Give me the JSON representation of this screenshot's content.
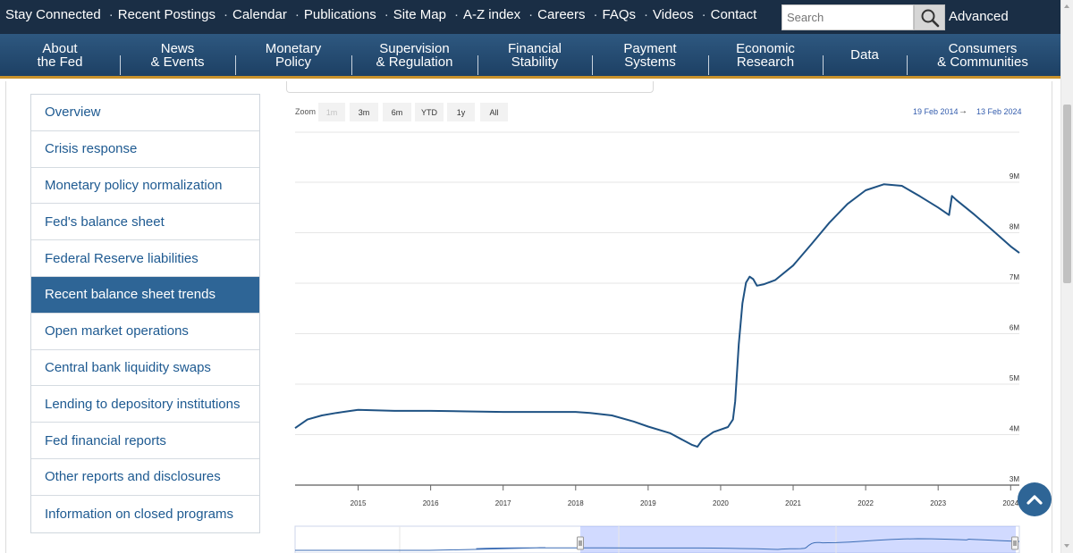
{
  "topbar": {
    "links": [
      "Stay Connected",
      "Recent Postings",
      "Calendar",
      "Publications",
      "Site Map",
      "A-Z index",
      "Careers",
      "FAQs",
      "Videos",
      "Contact"
    ],
    "search_placeholder": "Search",
    "advanced_label": "Advanced"
  },
  "nav": {
    "items": [
      "About\nthe Fed",
      "News\n& Events",
      "Monetary\nPolicy",
      "Supervision\n& Regulation",
      "Financial\nStability",
      "Payment\nSystems",
      "Economic\nResearch",
      "Data",
      "Consumers\n& Communities"
    ]
  },
  "sidebar": {
    "items": [
      {
        "label": "Overview",
        "active": false
      },
      {
        "label": "Crisis response",
        "active": false
      },
      {
        "label": "Monetary policy normalization",
        "active": false
      },
      {
        "label": "Fed's balance sheet",
        "active": false
      },
      {
        "label": "Federal Reserve liabilities",
        "active": false
      },
      {
        "label": "Recent balance sheet trends",
        "active": true
      },
      {
        "label": "Open market operations",
        "active": false
      },
      {
        "label": "Central bank liquidity swaps",
        "active": false
      },
      {
        "label": "Lending to depository institutions",
        "active": false
      },
      {
        "label": "Fed financial reports",
        "active": false
      },
      {
        "label": "Other reports and disclosures",
        "active": false
      },
      {
        "label": "Information on closed programs",
        "active": false
      }
    ]
  },
  "range_selector": {
    "zoom_label": "Zoom",
    "buttons": [
      {
        "label": "1m",
        "enabled": false
      },
      {
        "label": "3m",
        "enabled": true
      },
      {
        "label": "6m",
        "enabled": true
      },
      {
        "label": "YTD",
        "enabled": true
      },
      {
        "label": "1y",
        "enabled": true
      },
      {
        "label": "All",
        "enabled": true
      }
    ],
    "from_date": "19 Feb 2014",
    "arrow": "→",
    "to_date": "13 Feb 2024"
  },
  "chart_data": {
    "type": "line",
    "title": "",
    "xlabel": "",
    "ylabel": "",
    "y_unit": "M",
    "ylim": [
      3,
      9
    ],
    "yticks": [
      "3M",
      "4M",
      "5M",
      "6M",
      "7M",
      "8M",
      "9M"
    ],
    "xticks": [
      "2015",
      "2016",
      "2017",
      "2018",
      "2019",
      "2020",
      "2021",
      "2022",
      "2023",
      "2024"
    ],
    "xlim": [
      2014.13,
      2024.12
    ],
    "grid": true,
    "series": [
      {
        "x": [
          2014.13,
          2014.3,
          2014.5,
          2014.7,
          2014.9,
          2015.0,
          2015.5,
          2016.0,
          2016.5,
          2017.0,
          2017.5,
          2018.0,
          2018.2,
          2018.5,
          2018.8,
          2019.0,
          2019.3,
          2019.6,
          2019.68,
          2019.75,
          2019.9,
          2020.1,
          2020.17,
          2020.2,
          2020.25,
          2020.3,
          2020.35,
          2020.4,
          2020.45,
          2020.5,
          2020.6,
          2020.75,
          2021.0,
          2021.25,
          2021.5,
          2021.75,
          2022.0,
          2022.25,
          2022.5,
          2022.75,
          2023.0,
          2023.15,
          2023.19,
          2023.25,
          2023.5,
          2023.75,
          2024.0,
          2024.12
        ],
        "values": [
          4.13,
          4.3,
          4.38,
          4.43,
          4.47,
          4.49,
          4.47,
          4.47,
          4.46,
          4.45,
          4.45,
          4.45,
          4.43,
          4.38,
          4.26,
          4.16,
          4.03,
          3.8,
          3.76,
          3.9,
          4.05,
          4.15,
          4.3,
          4.66,
          5.79,
          6.6,
          7.01,
          7.13,
          7.08,
          6.95,
          6.98,
          7.06,
          7.35,
          7.77,
          8.2,
          8.57,
          8.84,
          8.96,
          8.93,
          8.72,
          8.5,
          8.35,
          8.73,
          8.65,
          8.36,
          8.05,
          7.73,
          7.6
        ]
      }
    ]
  }
}
